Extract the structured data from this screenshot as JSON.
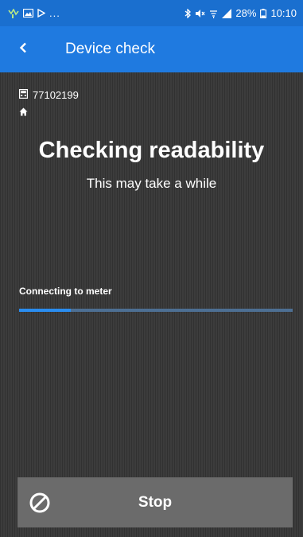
{
  "status_bar": {
    "left_icons": [
      "signal-activity-icon",
      "image-icon",
      "play-icon"
    ],
    "more_indicator": "...",
    "right_icons": [
      "bluetooth-icon",
      "mute-icon",
      "wifi-icon",
      "cellular-signal-icon"
    ],
    "battery": "28%",
    "time": "10:10",
    "color": "#1a6fcf"
  },
  "app_bar": {
    "title": "Device check",
    "back_icon": "chevron-left-icon",
    "color": "#1f7ae0"
  },
  "device": {
    "id": "77102199",
    "meter_icon": "meter-icon",
    "home_icon": "home-icon"
  },
  "main": {
    "heading": "Checking readability",
    "subheading": "This may take a while",
    "progress_label": "Connecting to meter",
    "progress_fraction": 0.19
  },
  "stop_button": {
    "label": "Stop",
    "icon": "cancel-icon"
  }
}
